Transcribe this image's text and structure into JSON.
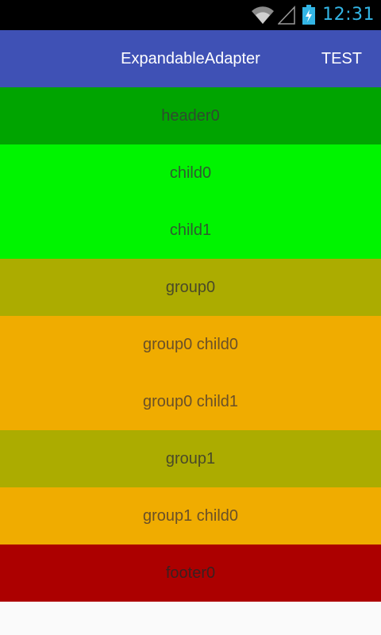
{
  "status_bar": {
    "time": "12:31",
    "icons": [
      "wifi-icon",
      "signal-icon",
      "battery-charging-icon"
    ],
    "clock_color": "#33b5e5"
  },
  "app_bar": {
    "title": "ExpandableAdapter",
    "action": "TEST",
    "color": "#3f51b5"
  },
  "list": {
    "header": "header0",
    "children": [
      "child0",
      "child1"
    ],
    "group0": {
      "label": "group0",
      "children": [
        "group0 child0",
        "group0 child1"
      ]
    },
    "group1": {
      "label": "group1",
      "children": [
        "group1 child0"
      ]
    },
    "footer": "footer0"
  },
  "colors": {
    "header": "#00a400",
    "child": "#00f400",
    "group": "#acac00",
    "group_child": "#f0ac00",
    "footer": "#ac0000"
  }
}
